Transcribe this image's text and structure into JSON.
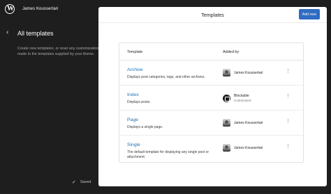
{
  "topbar": {
    "site_title": "James Koussertari",
    "logo": "wordpress-icon"
  },
  "sidebar": {
    "back_icon": "chevron-left-icon",
    "title": "All templates",
    "description": "Create new templates, or reset any customizations made to the templates supplied by your theme.",
    "saved_label": "Saved",
    "saved_icon": "check-icon"
  },
  "panel": {
    "title": "Templates",
    "add_new_label": "Add new",
    "columns": {
      "template": "Template",
      "added_by": "Added by"
    },
    "rows": [
      {
        "title": "Archive",
        "description": "Displays post categories, tags, and other archives.",
        "author": "James Koussertari",
        "author_sub": "",
        "author_type": "avatar"
      },
      {
        "title": "Index",
        "description": "Displays posts.",
        "author": "Blockable",
        "author_sub": "Customized",
        "author_type": "theme"
      },
      {
        "title": "Page",
        "description": "Displays a single page.",
        "author": "James Koussertari",
        "author_sub": "",
        "author_type": "avatar"
      },
      {
        "title": "Single",
        "description": "The default template for displaying any single post or attachment.",
        "author": "James Koussertari",
        "author_sub": "",
        "author_type": "avatar"
      }
    ],
    "more_icon": "more-vertical-icon"
  },
  "colors": {
    "accent": "#2f6cc2",
    "link": "#2271b1",
    "background": "#1e1e1e"
  }
}
